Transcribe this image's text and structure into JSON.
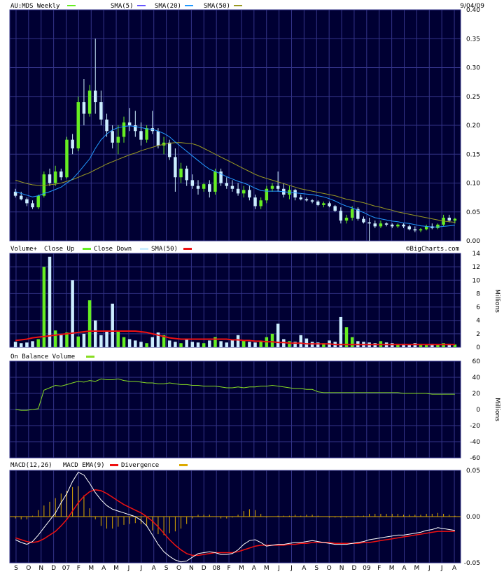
{
  "header": {
    "symbol_label": "AU:MDS Weekly",
    "sma5_label": "SMA(5)",
    "sma20_label": "SMA(20)",
    "sma50_label": "SMA(50)",
    "date": "9/04/09",
    "watermark": "©BigCharts.com"
  },
  "volume_panel": {
    "label_volume": "Volume+",
    "label_up": "Close Up",
    "label_down": "Close Down",
    "label_sma": "SMA(50)",
    "unit": "Millions"
  },
  "obv_panel": {
    "label": "On Balance Volume",
    "unit": "Millions"
  },
  "macd_panel": {
    "label_macd": "MACD(12,26)",
    "label_ema": "MACD EMA(9)",
    "label_div": "Divergence"
  },
  "x_labels": [
    "S",
    "O",
    "N",
    "D",
    "07",
    "F",
    "M",
    "A",
    "M",
    "J",
    "J",
    "A",
    "S",
    "O",
    "N",
    "D",
    "08",
    "F",
    "M",
    "A",
    "M",
    "J",
    "J",
    "A",
    "S",
    "O",
    "N",
    "D",
    "09",
    "F",
    "M",
    "A",
    "M",
    "J",
    "J",
    "A"
  ],
  "colors": {
    "bg": "#000033",
    "grid": "#333388",
    "up": "#66ee22",
    "down": "#cceeff",
    "sma5": "#6655ff",
    "sma20": "#2299ff",
    "sma50": "#999922",
    "vol_sma": "#ee1111",
    "obv": "#88dd22",
    "macd": "#ffffff",
    "macd_ema": "#ee1111",
    "divergence": "#ddaa00"
  },
  "chart_data": [
    {
      "type": "candlestick",
      "title": "AU:MDS Weekly",
      "ylim": [
        0,
        0.4
      ],
      "yticks": [
        "0.00",
        "0.05",
        "0.10",
        "0.15",
        "0.20",
        "0.25",
        "0.30",
        "0.35",
        "0.40"
      ],
      "ohlc_weekly": [
        [
          0.085,
          0.09,
          0.075,
          0.078
        ],
        [
          0.078,
          0.085,
          0.07,
          0.072
        ],
        [
          0.072,
          0.075,
          0.06,
          0.065
        ],
        [
          0.065,
          0.07,
          0.055,
          0.058
        ],
        [
          0.058,
          0.08,
          0.055,
          0.078
        ],
        [
          0.078,
          0.12,
          0.075,
          0.115
        ],
        [
          0.115,
          0.125,
          0.095,
          0.1
        ],
        [
          0.1,
          0.13,
          0.095,
          0.12
        ],
        [
          0.12,
          0.125,
          0.105,
          0.11
        ],
        [
          0.11,
          0.18,
          0.108,
          0.175
        ],
        [
          0.175,
          0.185,
          0.15,
          0.16
        ],
        [
          0.16,
          0.25,
          0.155,
          0.24
        ],
        [
          0.24,
          0.28,
          0.2,
          0.22
        ],
        [
          0.22,
          0.27,
          0.215,
          0.26
        ],
        [
          0.26,
          0.35,
          0.22,
          0.24
        ],
        [
          0.24,
          0.26,
          0.2,
          0.21
        ],
        [
          0.21,
          0.22,
          0.18,
          0.19
        ],
        [
          0.19,
          0.2,
          0.16,
          0.17
        ],
        [
          0.17,
          0.2,
          0.15,
          0.18
        ],
        [
          0.18,
          0.215,
          0.17,
          0.205
        ],
        [
          0.205,
          0.23,
          0.19,
          0.2
        ],
        [
          0.2,
          0.225,
          0.18,
          0.19
        ],
        [
          0.19,
          0.205,
          0.165,
          0.175
        ],
        [
          0.175,
          0.2,
          0.17,
          0.195
        ],
        [
          0.195,
          0.225,
          0.185,
          0.19
        ],
        [
          0.19,
          0.195,
          0.16,
          0.165
        ],
        [
          0.165,
          0.18,
          0.15,
          0.17
        ],
        [
          0.17,
          0.175,
          0.14,
          0.145
        ],
        [
          0.145,
          0.16,
          0.085,
          0.11
        ],
        [
          0.11,
          0.135,
          0.1,
          0.125
        ],
        [
          0.125,
          0.13,
          0.095,
          0.105
        ],
        [
          0.105,
          0.115,
          0.09,
          0.095
        ],
        [
          0.095,
          0.105,
          0.08,
          0.09
        ],
        [
          0.09,
          0.1,
          0.085,
          0.098
        ],
        [
          0.098,
          0.105,
          0.075,
          0.085
        ],
        [
          0.085,
          0.125,
          0.08,
          0.12
        ],
        [
          0.12,
          0.125,
          0.095,
          0.1
        ],
        [
          0.1,
          0.11,
          0.09,
          0.095
        ],
        [
          0.095,
          0.105,
          0.085,
          0.09
        ],
        [
          0.09,
          0.1,
          0.078,
          0.082
        ],
        [
          0.082,
          0.095,
          0.075,
          0.088
        ],
        [
          0.088,
          0.095,
          0.07,
          0.075
        ],
        [
          0.075,
          0.08,
          0.055,
          0.06
        ],
        [
          0.06,
          0.075,
          0.055,
          0.07
        ],
        [
          0.07,
          0.095,
          0.065,
          0.09
        ],
        [
          0.09,
          0.1,
          0.085,
          0.095
        ],
        [
          0.095,
          0.12,
          0.085,
          0.09
        ],
        [
          0.09,
          0.1,
          0.075,
          0.08
        ],
        [
          0.08,
          0.095,
          0.072,
          0.088
        ],
        [
          0.088,
          0.09,
          0.07,
          0.075
        ],
        [
          0.075,
          0.08,
          0.07,
          0.072
        ],
        [
          0.072,
          0.075,
          0.068,
          0.07
        ],
        [
          0.07,
          0.072,
          0.065,
          0.068
        ],
        [
          0.068,
          0.07,
          0.06,
          0.062
        ],
        [
          0.062,
          0.068,
          0.058,
          0.065
        ],
        [
          0.065,
          0.068,
          0.058,
          0.06
        ],
        [
          0.06,
          0.062,
          0.05,
          0.052
        ],
        [
          0.052,
          0.058,
          0.03,
          0.035
        ],
        [
          0.035,
          0.045,
          0.03,
          0.04
        ],
        [
          0.04,
          0.06,
          0.035,
          0.055
        ],
        [
          0.055,
          0.058,
          0.035,
          0.038
        ],
        [
          0.038,
          0.042,
          0.03,
          0.032
        ],
        [
          0.032,
          0.04,
          0.0,
          0.03
        ],
        [
          0.03,
          0.035,
          0.022,
          0.025
        ],
        [
          0.025,
          0.035,
          0.022,
          0.03
        ],
        [
          0.03,
          0.032,
          0.025,
          0.028
        ],
        [
          0.028,
          0.03,
          0.022,
          0.025
        ],
        [
          0.025,
          0.03,
          0.022,
          0.028
        ],
        [
          0.028,
          0.03,
          0.022,
          0.025
        ],
        [
          0.025,
          0.028,
          0.018,
          0.02
        ],
        [
          0.02,
          0.025,
          0.015,
          0.018
        ],
        [
          0.018,
          0.022,
          0.015,
          0.02
        ],
        [
          0.02,
          0.028,
          0.018,
          0.025
        ],
        [
          0.025,
          0.03,
          0.02,
          0.022
        ],
        [
          0.022,
          0.03,
          0.02,
          0.028
        ],
        [
          0.028,
          0.045,
          0.025,
          0.04
        ],
        [
          0.04,
          0.045,
          0.032,
          0.035
        ],
        [
          0.035,
          0.04,
          0.03,
          0.038
        ]
      ],
      "sma20": [
        0.085,
        0.082,
        0.079,
        0.076,
        0.078,
        0.082,
        0.085,
        0.089,
        0.093,
        0.1,
        0.107,
        0.118,
        0.13,
        0.142,
        0.16,
        0.175,
        0.185,
        0.192,
        0.196,
        0.198,
        0.199,
        0.198,
        0.196,
        0.194,
        0.193,
        0.19,
        0.186,
        0.18,
        0.171,
        0.163,
        0.155,
        0.147,
        0.139,
        0.131,
        0.124,
        0.12,
        0.116,
        0.111,
        0.107,
        0.103,
        0.1,
        0.096,
        0.091,
        0.087,
        0.086,
        0.086,
        0.086,
        0.085,
        0.084,
        0.083,
        0.082,
        0.081,
        0.08,
        0.078,
        0.076,
        0.073,
        0.069,
        0.064,
        0.06,
        0.057,
        0.053,
        0.049,
        0.044,
        0.04,
        0.038,
        0.036,
        0.034,
        0.033,
        0.031,
        0.03,
        0.028,
        0.026,
        0.025,
        0.024,
        0.024,
        0.025,
        0.026,
        0.027
      ],
      "sma50": [
        0.105,
        0.102,
        0.099,
        0.097,
        0.096,
        0.096,
        0.097,
        0.098,
        0.1,
        0.103,
        0.106,
        0.11,
        0.114,
        0.118,
        0.123,
        0.128,
        0.133,
        0.137,
        0.141,
        0.145,
        0.149,
        0.152,
        0.156,
        0.159,
        0.162,
        0.165,
        0.167,
        0.169,
        0.17,
        0.17,
        0.169,
        0.168,
        0.165,
        0.16,
        0.155,
        0.15,
        0.145,
        0.14,
        0.135,
        0.13,
        0.125,
        0.12,
        0.115,
        0.111,
        0.108,
        0.105,
        0.102,
        0.099,
        0.096,
        0.093,
        0.09,
        0.088,
        0.086,
        0.084,
        0.082,
        0.08,
        0.078,
        0.075,
        0.072,
        0.07,
        0.068,
        0.066,
        0.063,
        0.06,
        0.058,
        0.055,
        0.053,
        0.05,
        0.048,
        0.046,
        0.044,
        0.042,
        0.04,
        0.038,
        0.036,
        0.034,
        0.033,
        0.032
      ]
    },
    {
      "type": "bar",
      "title": "Volume",
      "ylabel": "Millions",
      "ylim": [
        0,
        14
      ],
      "yticks": [
        "0",
        "2",
        "4",
        "6",
        "8",
        "10",
        "12",
        "14"
      ],
      "volume_millions": [
        0.8,
        0.6,
        0.7,
        0.9,
        1.2,
        12.0,
        13.5,
        2.5,
        1.8,
        2.2,
        10.0,
        1.6,
        2.0,
        7.0,
        4.0,
        1.8,
        2.5,
        6.5,
        2.4,
        1.5,
        1.2,
        1.0,
        0.8,
        0.6,
        1.5,
        2.2,
        1.8,
        1.0,
        0.8,
        0.6,
        1.2,
        0.8,
        0.7,
        0.6,
        1.0,
        1.5,
        0.9,
        0.7,
        1.2,
        1.8,
        1.0,
        0.8,
        0.7,
        0.9,
        1.5,
        2.0,
        3.5,
        1.2,
        0.9,
        0.8,
        1.8,
        1.3,
        0.8,
        0.7,
        0.6,
        1.0,
        0.8,
        4.5,
        3.0,
        1.5,
        0.9,
        0.8,
        0.7,
        0.6,
        0.9,
        0.7,
        0.6,
        0.5,
        0.5,
        0.4,
        0.6,
        0.5,
        0.4,
        0.5,
        0.4,
        0.6,
        0.5,
        0.4
      ],
      "sma50_millions": [
        1.0,
        1.1,
        1.2,
        1.4,
        1.5,
        1.6,
        1.7,
        1.8,
        1.9,
        2.0,
        2.1,
        2.2,
        2.3,
        2.4,
        2.4,
        2.4,
        2.4,
        2.4,
        2.4,
        2.4,
        2.4,
        2.4,
        2.3,
        2.2,
        2.0,
        1.8,
        1.6,
        1.4,
        1.3,
        1.2,
        1.2,
        1.2,
        1.2,
        1.2,
        1.2,
        1.2,
        1.2,
        1.2,
        1.1,
        1.1,
        1.0,
        1.0,
        0.9,
        0.9,
        0.8,
        0.8,
        0.7,
        0.7,
        0.6,
        0.6,
        0.6,
        0.5,
        0.5,
        0.5,
        0.5,
        0.5,
        0.4,
        0.4,
        0.4,
        0.4,
        0.4,
        0.4,
        0.4,
        0.4,
        0.4,
        0.4,
        0.4,
        0.4,
        0.4,
        0.4,
        0.4,
        0.4,
        0.4,
        0.4,
        0.4,
        0.4,
        0.4,
        0.4
      ]
    },
    {
      "type": "line",
      "title": "On Balance Volume",
      "ylabel": "Millions",
      "ylim": [
        -60,
        60
      ],
      "yticks": [
        "60",
        "40",
        "20",
        "0",
        "-20",
        "-40",
        "-60"
      ],
      "obv_millions": [
        0,
        -1,
        -1,
        0,
        1,
        24,
        27,
        30,
        29,
        31,
        33,
        35,
        34,
        36,
        35,
        38,
        37,
        37,
        38,
        36,
        35,
        35,
        34,
        33,
        33,
        32,
        32,
        33,
        32,
        31,
        31,
        30,
        30,
        29,
        29,
        29,
        28,
        27,
        27,
        28,
        27,
        28,
        28,
        29,
        29,
        30,
        29,
        28,
        27,
        26,
        26,
        25,
        25,
        22,
        21,
        21,
        21,
        21,
        21,
        21,
        21,
        21,
        21,
        21,
        21,
        21,
        21,
        21,
        20,
        20,
        20,
        20,
        20,
        19,
        19,
        19,
        19,
        19
      ]
    },
    {
      "type": "line",
      "title": "MACD(12,26)",
      "ylim": [
        -0.05,
        0.05
      ],
      "yticks": [
        "0.05",
        "0.00",
        "-0.05"
      ],
      "macd": [
        -0.025,
        -0.028,
        -0.03,
        -0.027,
        -0.02,
        -0.012,
        -0.004,
        0.004,
        0.015,
        0.025,
        0.038,
        0.048,
        0.045,
        0.036,
        0.026,
        0.018,
        0.012,
        0.008,
        0.006,
        0.004,
        0.002,
        0.0,
        -0.004,
        -0.01,
        -0.02,
        -0.03,
        -0.038,
        -0.043,
        -0.047,
        -0.049,
        -0.048,
        -0.044,
        -0.04,
        -0.039,
        -0.038,
        -0.039,
        -0.041,
        -0.041,
        -0.04,
        -0.036,
        -0.03,
        -0.026,
        -0.025,
        -0.028,
        -0.032,
        -0.031,
        -0.03,
        -0.03,
        -0.029,
        -0.028,
        -0.028,
        -0.027,
        -0.026,
        -0.027,
        -0.028,
        -0.029,
        -0.03,
        -0.03,
        -0.03,
        -0.029,
        -0.028,
        -0.027,
        -0.025,
        -0.024,
        -0.023,
        -0.022,
        -0.021,
        -0.02,
        -0.02,
        -0.019,
        -0.018,
        -0.017,
        -0.015,
        -0.014,
        -0.012,
        -0.013,
        -0.014,
        -0.015
      ],
      "macd_ema": [
        -0.023,
        -0.025,
        -0.027,
        -0.028,
        -0.027,
        -0.024,
        -0.02,
        -0.016,
        -0.01,
        -0.003,
        0.006,
        0.015,
        0.022,
        0.027,
        0.029,
        0.028,
        0.025,
        0.021,
        0.017,
        0.013,
        0.01,
        0.007,
        0.004,
        0.0,
        -0.005,
        -0.011,
        -0.018,
        -0.025,
        -0.031,
        -0.036,
        -0.04,
        -0.042,
        -0.042,
        -0.041,
        -0.04,
        -0.039,
        -0.039,
        -0.039,
        -0.039,
        -0.038,
        -0.036,
        -0.034,
        -0.032,
        -0.031,
        -0.031,
        -0.031,
        -0.031,
        -0.031,
        -0.03,
        -0.03,
        -0.029,
        -0.029,
        -0.028,
        -0.028,
        -0.028,
        -0.028,
        -0.029,
        -0.029,
        -0.029,
        -0.029,
        -0.029,
        -0.028,
        -0.028,
        -0.027,
        -0.026,
        -0.025,
        -0.024,
        -0.023,
        -0.022,
        -0.021,
        -0.02,
        -0.019,
        -0.018,
        -0.017,
        -0.016,
        -0.016,
        -0.016,
        -0.016
      ]
    }
  ]
}
